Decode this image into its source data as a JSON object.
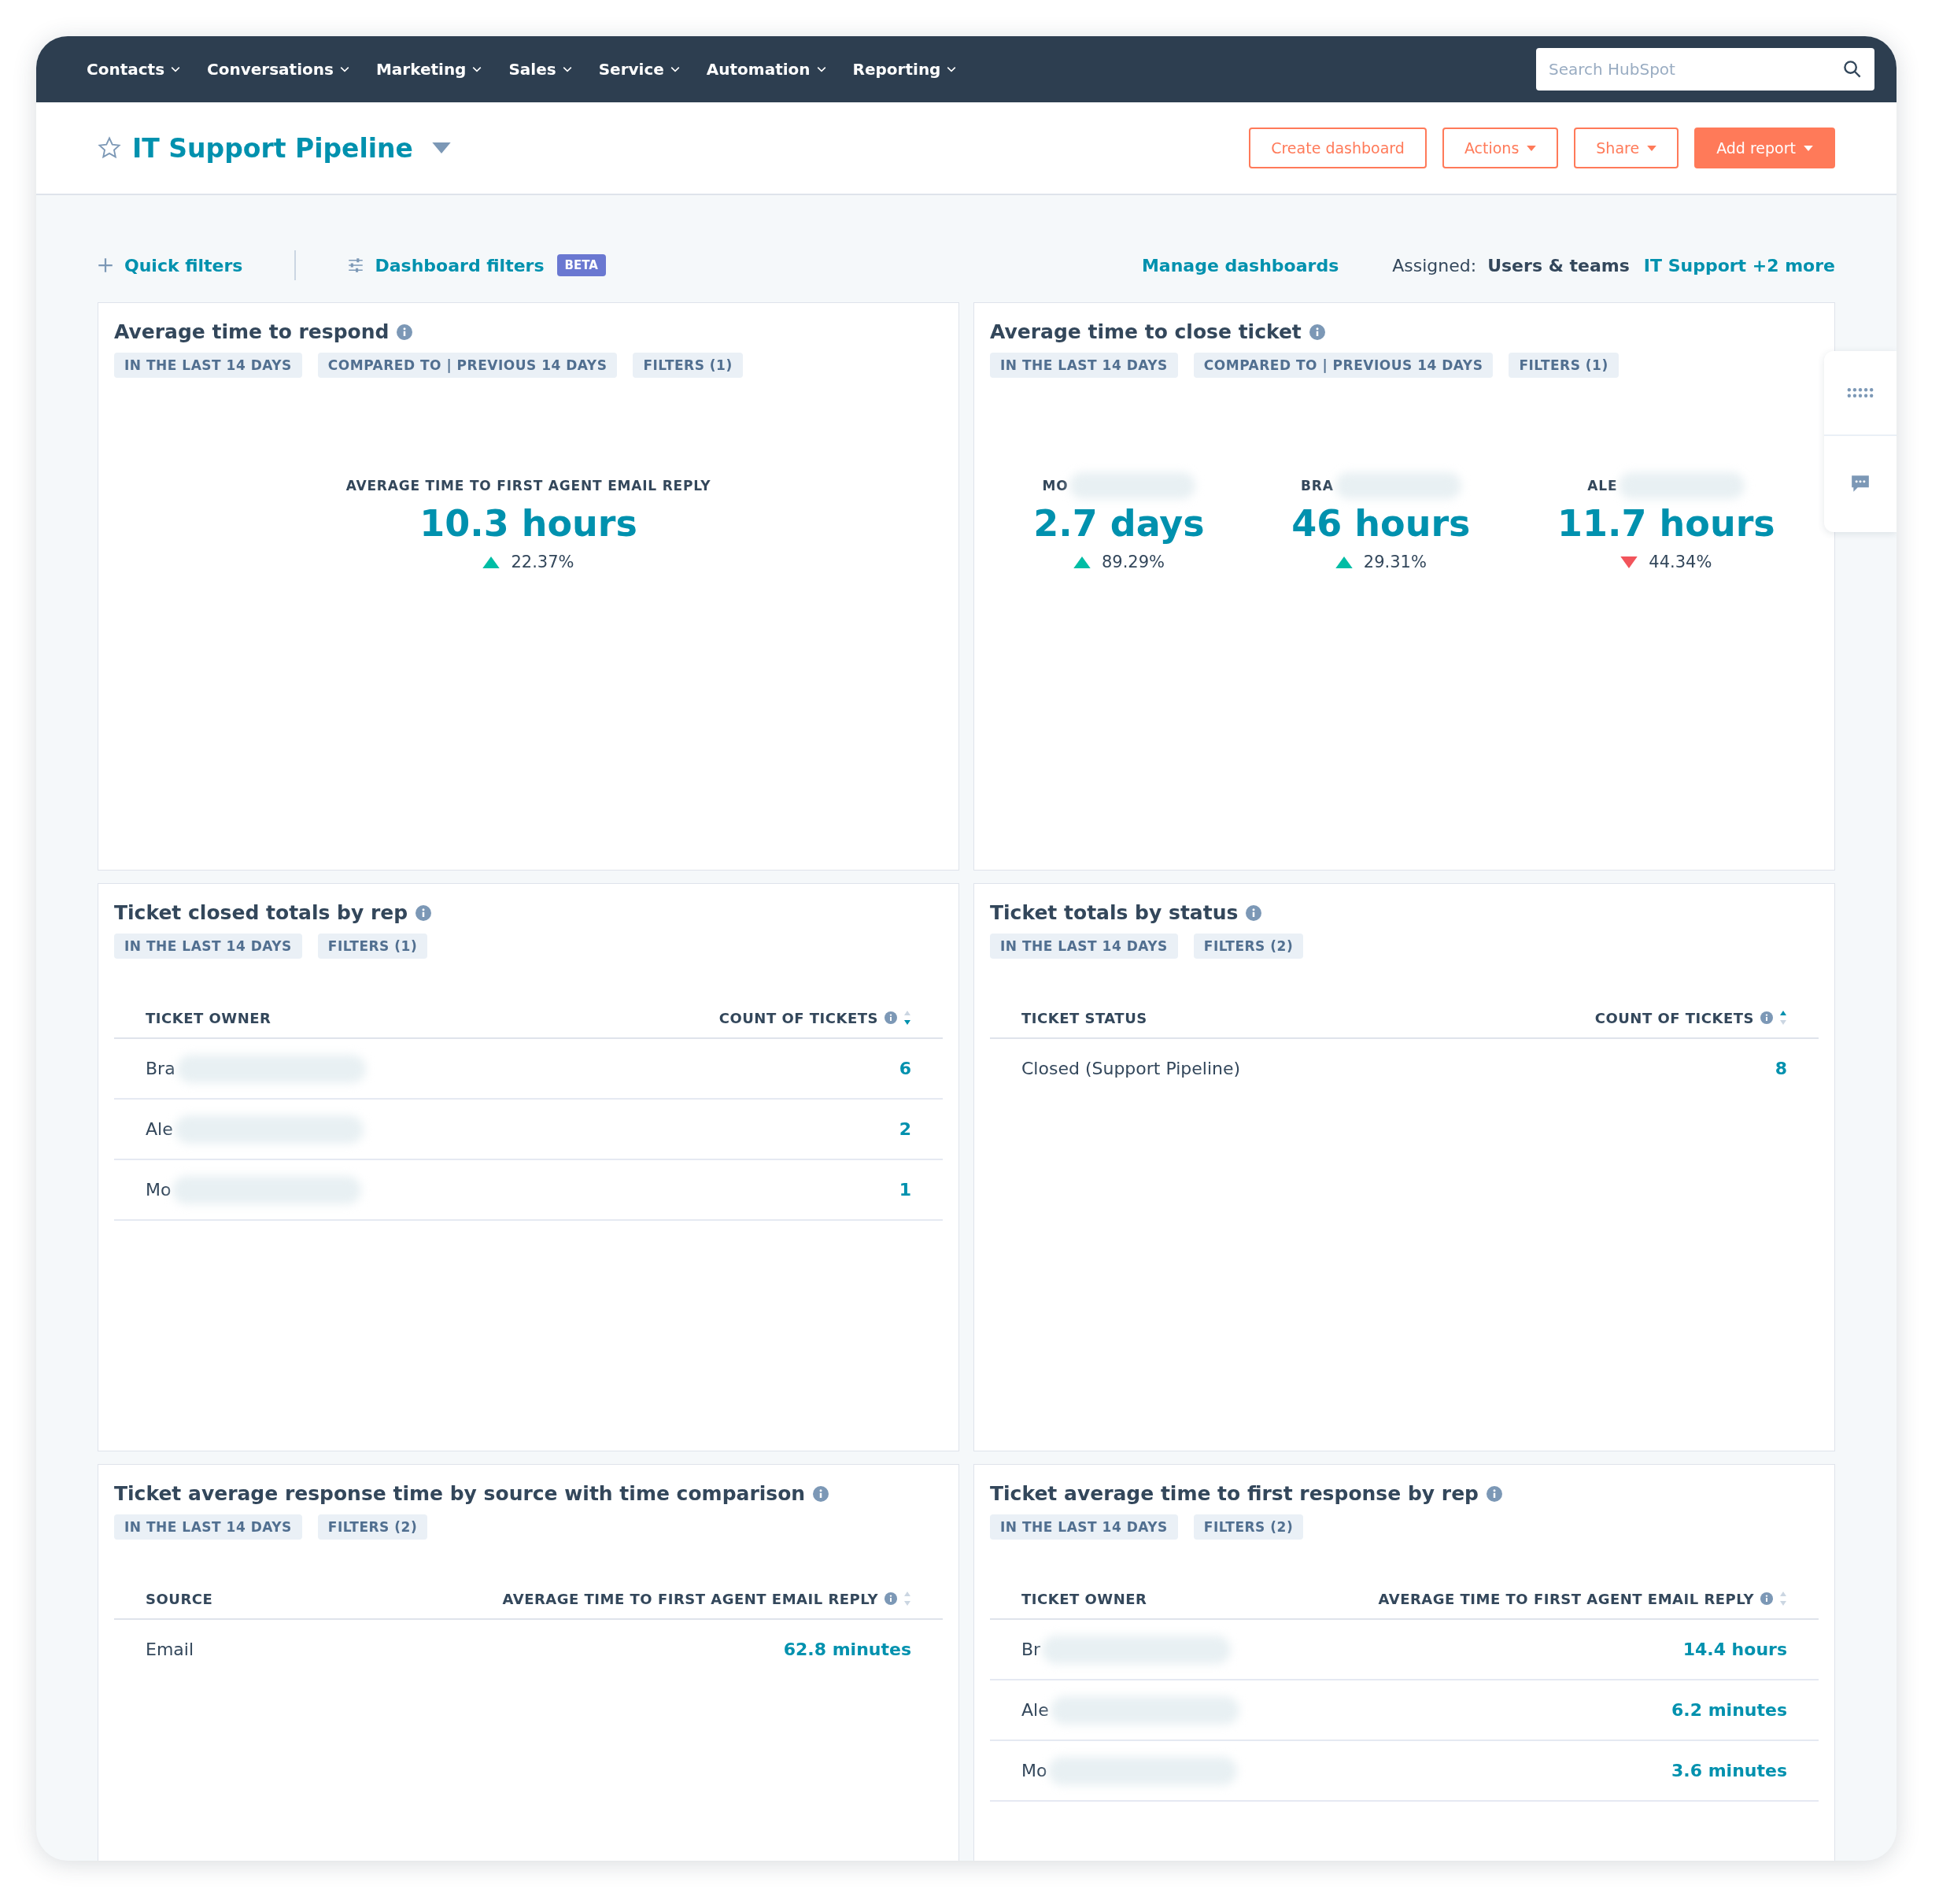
{
  "nav": {
    "items": [
      {
        "label": "Contacts"
      },
      {
        "label": "Conversations"
      },
      {
        "label": "Marketing"
      },
      {
        "label": "Sales"
      },
      {
        "label": "Service"
      },
      {
        "label": "Automation"
      },
      {
        "label": "Reporting"
      }
    ],
    "search": {
      "placeholder": "Search HubSpot"
    }
  },
  "header": {
    "title": "IT Support Pipeline",
    "favorite": false,
    "buttons": [
      {
        "label": "Create dashboard",
        "kind": "outline",
        "caret": false
      },
      {
        "label": "Actions",
        "kind": "outline",
        "caret": true
      },
      {
        "label": "Share",
        "kind": "outline",
        "caret": true
      },
      {
        "label": "Add report",
        "kind": "primary",
        "caret": true
      }
    ]
  },
  "filter_bar": {
    "quick_filters": "Quick filters",
    "dashboard_filters": "Dashboard filters",
    "badge": "BETA",
    "manage": "Manage dashboards",
    "assigned_label": "Assigned:",
    "assigned_value": "Users & teams",
    "assigned_link": "IT Support +2 more"
  },
  "cards": [
    {
      "kind": "kpi",
      "title": "Average time to respond",
      "tags": [
        "IN THE LAST 14 DAYS",
        "COMPARED TO | PREVIOUS 14 DAYS",
        "FILTERS (1)"
      ],
      "metrics": [
        {
          "label": "AVERAGE TIME TO FIRST AGENT EMAIL REPLY",
          "redacted": false,
          "value": "10.3 hours",
          "change": "22.37%",
          "trend_up": true
        }
      ]
    },
    {
      "kind": "kpi",
      "title": "Average time to close ticket",
      "tags": [
        "IN THE LAST 14 DAYS",
        "COMPARED TO | PREVIOUS 14 DAYS",
        "FILTERS (1)"
      ],
      "metrics": [
        {
          "label": "MO",
          "redacted": true,
          "value": "2.7 days",
          "change": "89.29%",
          "trend_up": true
        },
        {
          "label": "BRA",
          "redacted": true,
          "value": "46 hours",
          "change": "29.31%",
          "trend_up": true
        },
        {
          "label": "ALE",
          "redacted": true,
          "value": "11.7 hours",
          "change": "44.34%",
          "trend_up": false
        }
      ]
    },
    {
      "kind": "table",
      "title": "Ticket closed totals by rep",
      "tags": [
        "IN THE LAST 14 DAYS",
        "FILTERS (1)"
      ],
      "columns": [
        "TICKET OWNER",
        "COUNT OF TICKETS"
      ],
      "sorted_ascending": false,
      "sorted_descending": true,
      "rows": [
        {
          "cells": [
            "Bra",
            "6"
          ],
          "redacted": true
        },
        {
          "cells": [
            "Ale",
            "2"
          ],
          "redacted": true
        },
        {
          "cells": [
            "Mo",
            "1"
          ],
          "redacted": true
        }
      ]
    },
    {
      "kind": "table",
      "title": "Ticket totals by status",
      "tags": [
        "IN THE LAST 14 DAYS",
        "FILTERS (2)"
      ],
      "columns": [
        "TICKET STATUS",
        "COUNT OF TICKETS"
      ],
      "sorted_ascending": true,
      "sorted_descending": false,
      "rows": [
        {
          "cells": [
            "Closed (Support Pipeline)",
            "8"
          ],
          "redacted": false
        }
      ]
    },
    {
      "kind": "table",
      "title": "Ticket average response time by source with time comparison",
      "tags": [
        "IN THE LAST 14 DAYS",
        "FILTERS (2)"
      ],
      "columns": [
        "SOURCE",
        "AVERAGE TIME TO FIRST AGENT EMAIL REPLY"
      ],
      "sorted_ascending": false,
      "sorted_descending": false,
      "rows": [
        {
          "cells": [
            "Email",
            "62.8 minutes"
          ],
          "redacted": false
        }
      ]
    },
    {
      "kind": "table",
      "title": "Ticket average time to first response by rep",
      "tags": [
        "IN THE LAST 14 DAYS",
        "FILTERS (2)"
      ],
      "columns": [
        "TICKET OWNER",
        "AVERAGE TIME TO FIRST AGENT EMAIL REPLY"
      ],
      "sorted_ascending": false,
      "sorted_descending": false,
      "rows": [
        {
          "cells": [
            "Br",
            "14.4 hours"
          ],
          "redacted": true
        },
        {
          "cells": [
            "Ale",
            "6.2 minutes"
          ],
          "redacted": true
        },
        {
          "cells": [
            "Mo",
            "3.6 minutes"
          ],
          "redacted": true
        }
      ]
    }
  ]
}
